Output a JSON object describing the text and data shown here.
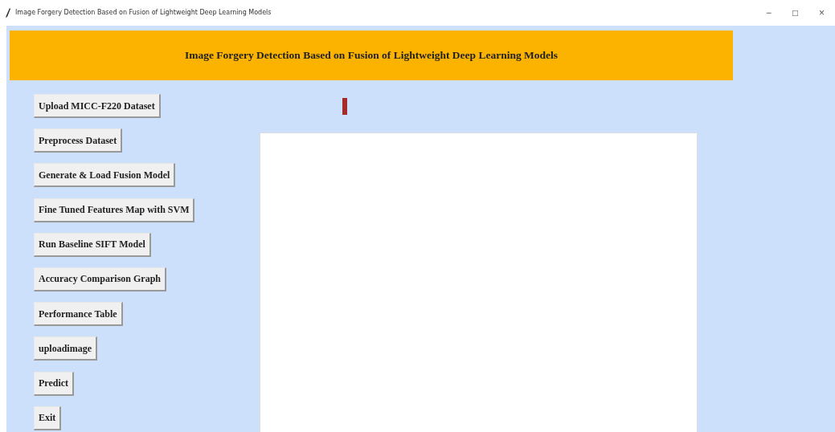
{
  "window": {
    "title": "Image Forgery Detection Based on Fusion of Lightweight Deep Learning Models",
    "controls": [
      "−",
      "□",
      "×"
    ]
  },
  "header": {
    "title": "Image Forgery Detection Based on Fusion of Lightweight Deep Learning Models"
  },
  "buttons": [
    "Upload MICC-F220 Dataset",
    "Preprocess Dataset",
    "Generate & Load Fusion Model",
    "Fine Tuned Features Map with SVM",
    "Run Baseline SIFT Model",
    "Accuracy Comparison Graph",
    "Performance Table",
    "uploadimage",
    "Predict",
    "Exit"
  ],
  "status_marker": {
    "color": "#a52a2a"
  }
}
